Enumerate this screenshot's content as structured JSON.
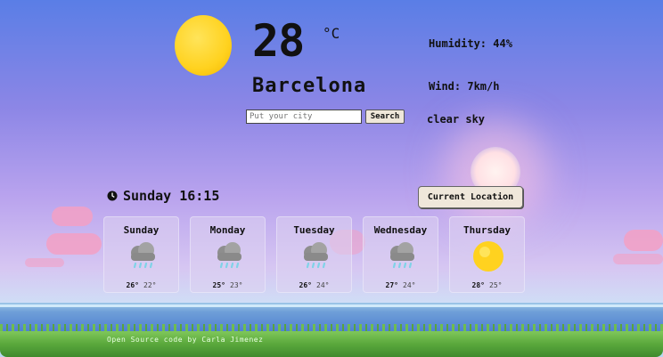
{
  "current": {
    "temperature": "28",
    "unit": "°C",
    "city": "Barcelona",
    "humidity": "Humidity: 44%",
    "wind": "Wind: 7km/h",
    "description": "clear sky",
    "icon": "sun-icon"
  },
  "search": {
    "placeholder": "Put your city",
    "value": "Put your city",
    "button_label": "Search"
  },
  "datetime": "Sunday 16:15",
  "location_button": "Current Location",
  "forecast": [
    {
      "day": "Sunday",
      "icon": "rain-cloud-icon",
      "max": "26°",
      "min": "22°"
    },
    {
      "day": "Monday",
      "icon": "rain-cloud-icon",
      "max": "25°",
      "min": "23°"
    },
    {
      "day": "Tuesday",
      "icon": "rain-cloud-icon",
      "max": "26°",
      "min": "24°"
    },
    {
      "day": "Wednesday",
      "icon": "rain-cloud-icon",
      "max": "27°",
      "min": "24°"
    },
    {
      "day": "Thursday",
      "icon": "sun-icon",
      "max": "28°",
      "min": "25°"
    }
  ],
  "footer": "Open Source code by Carla Jimenez",
  "colors": {
    "sun": "#ffd21f",
    "button_bg": "#efe7da",
    "card_bg": "#dcd2f0",
    "grass": "#5aa83c",
    "sea": "#4d7fd0"
  }
}
